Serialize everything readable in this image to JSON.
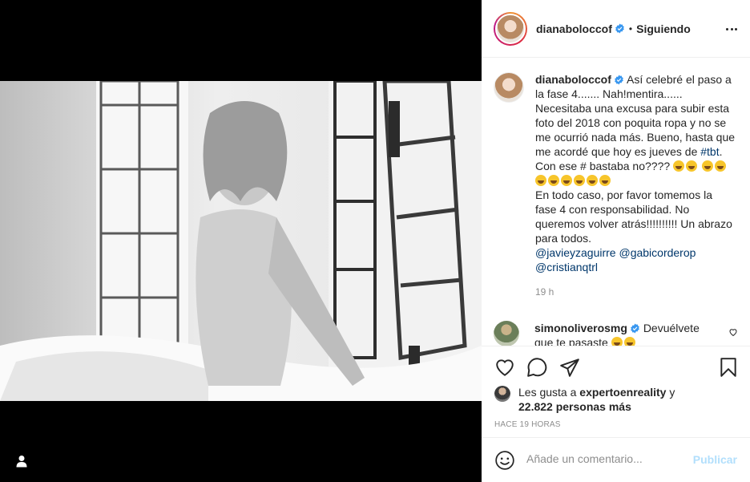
{
  "post": {
    "username": "dianaboloccof",
    "follow_status": "Siguiendo",
    "separator": "•"
  },
  "caption": {
    "username": "dianaboloccof",
    "line1": "Así celebré el paso a la fase 4....... Nah!mentira...... Necesitaba una excusa para subir esta foto del 2018 con poquita ropa y no se me ocurrió nada más. Bueno, hasta que me acordé que hoy es jueves de",
    "hashtag": "#tbt",
    "line2": ". Con ese # bastaba no????",
    "line3": "En todo caso, por favor tomemos la fase 4 con responsabilidad. No queremos volver atrás!!!!!!!!!! Un abrazo para todos.",
    "mention1": "@javieyzaguirre",
    "mention2": "@gabicorderop",
    "mention3": "@cristianqtrl",
    "time": "19 h"
  },
  "comment": {
    "username": "simonoliverosmg",
    "text": "Devuélvete que te pasaste"
  },
  "likes": {
    "prefix": "Les gusta a",
    "user": "expertoenreality",
    "joiner": "y",
    "count": "22.822 personas más"
  },
  "timestamp": "HACE 19 HORAS",
  "add_comment": {
    "placeholder": "Añade un comentario...",
    "publish_label": "Publicar"
  },
  "colors": {
    "verified": "#3897f0",
    "link": "#00376b",
    "publish_disabled": "#b2dffc"
  },
  "icons": [
    "user-tag-icon",
    "heart-icon",
    "comment-icon",
    "share-icon",
    "bookmark-icon",
    "emoji-icon",
    "more-icon",
    "verified-icon"
  ]
}
